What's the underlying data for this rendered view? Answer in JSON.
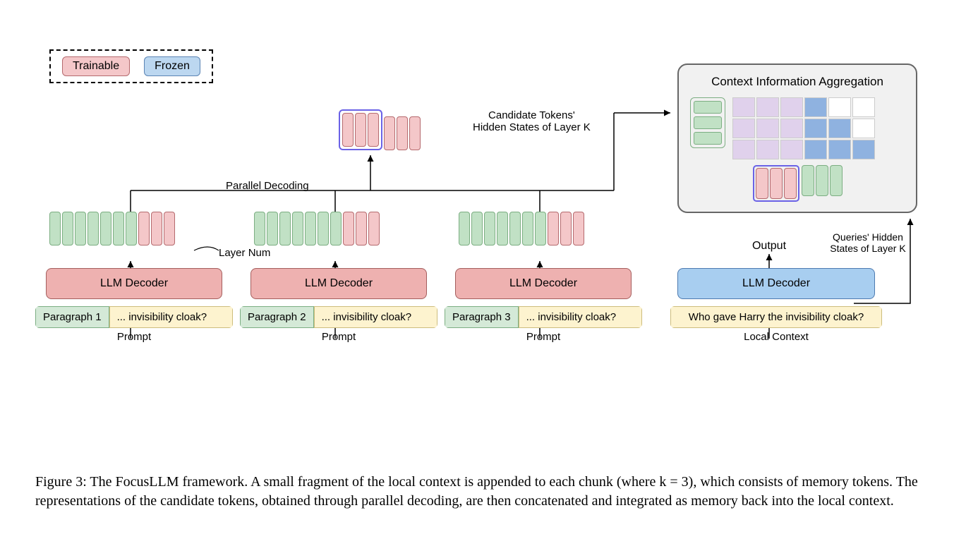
{
  "legend": {
    "trainable": "Trainable",
    "frozen": "Frozen"
  },
  "top_labels": {
    "parallel_decoding": "Parallel Decoding",
    "candidate": "Candidate Tokens'\nHidden States of Layer K",
    "layer_num": "Layer Num"
  },
  "columns": [
    {
      "tag_left": "Paragraph 1",
      "tag_right": "... invisibility cloak?",
      "sublabel": "Prompt",
      "decoder": "LLM Decoder"
    },
    {
      "tag_left": "Paragraph 2",
      "tag_right": "... invisibility cloak?",
      "sublabel": "Prompt",
      "decoder": "LLM Decoder"
    },
    {
      "tag_left": "Paragraph 3",
      "tag_right": "... invisibility cloak?",
      "sublabel": "Prompt",
      "decoder": "LLM Decoder"
    }
  ],
  "right_col": {
    "tag": "Who gave Harry the invisibility cloak?",
    "sublabel": "Local Context",
    "decoder": "LLM Decoder"
  },
  "agg": {
    "title": "Context Information Aggregation",
    "output_label": "Output",
    "queries_label": "Queries' Hidden States of Layer K"
  },
  "caption": "Figure 3: The FocusLLM framework. A small fragment of the local context is appended to each chunk (where k = 3), which consists of memory tokens. The representations of the candidate tokens, obtained through parallel decoding, are then concatenated and integrated as memory back into the local context."
}
